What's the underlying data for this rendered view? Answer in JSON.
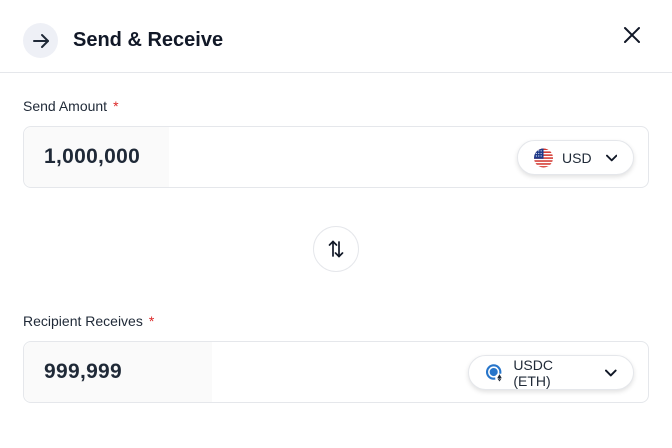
{
  "header": {
    "title": "Send & Receive",
    "header_icon": "arrow-right-icon",
    "close_icon": "close-icon"
  },
  "send": {
    "label": "Send Amount",
    "required_mark": "*",
    "value": "1,000,000",
    "currency": {
      "label": "USD",
      "icon": "us-flag-icon"
    }
  },
  "swap": {
    "icon": "swap-vertical-icon"
  },
  "receive": {
    "label": "Recipient Receives",
    "required_mark": "*",
    "value": "999,999",
    "currency": {
      "label": "USDC (ETH)",
      "icon": "usdc-eth-icon"
    }
  },
  "colors": {
    "required": "#dc2626",
    "usdc_blue": "#2775ca"
  }
}
